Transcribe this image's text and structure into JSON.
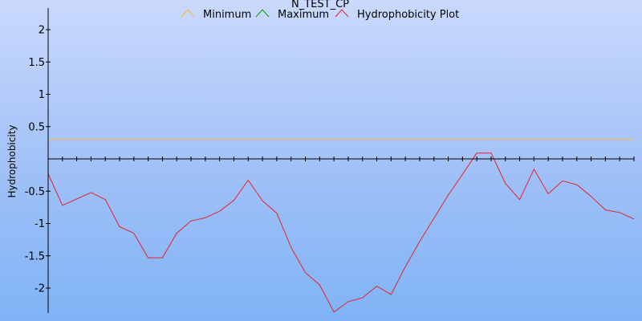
{
  "chart_data": {
    "type": "line",
    "title": "N_TEST_CP",
    "xlabel": "",
    "ylabel": "Hydrophobicity",
    "ylim": [
      -2.4,
      2.3
    ],
    "xlim": [
      0,
      41
    ],
    "yticks": [
      2,
      1.5,
      1,
      0.5,
      -0.5,
      -1,
      -1.5,
      -2
    ],
    "ytick_labels": [
      "2",
      "1.5",
      "1",
      "0.5",
      "-0.5",
      "-1",
      "-1.5",
      "-2"
    ],
    "grid": false,
    "legend_position": "top",
    "series": [
      {
        "name": "Minimum",
        "color": "#ffb733",
        "x": [
          0,
          41
        ],
        "values": [
          0.3,
          0.3
        ]
      },
      {
        "name": "Maximum",
        "color": "#00a000",
        "x": [],
        "values": []
      },
      {
        "name": "Hydrophobicity Plot",
        "color": "#e8202a",
        "x": [
          0,
          1,
          2,
          3,
          4,
          5,
          6,
          7,
          8,
          9,
          10,
          11,
          12,
          13,
          14,
          15,
          16,
          17,
          18,
          19,
          20,
          21,
          22,
          23,
          24,
          25,
          26,
          27,
          28,
          29,
          30,
          31,
          32,
          33,
          34,
          35,
          36,
          37,
          38,
          39,
          40,
          41
        ],
        "values": [
          -0.23,
          -0.72,
          -0.62,
          -0.52,
          -0.63,
          -1.05,
          -1.15,
          -1.53,
          -1.53,
          -1.15,
          -0.96,
          -0.91,
          -0.81,
          -0.64,
          -0.33,
          -0.65,
          -0.84,
          -1.37,
          -1.76,
          -1.95,
          -2.37,
          -2.21,
          -2.15,
          -1.97,
          -2.1,
          -1.67,
          -1.28,
          -0.92,
          -0.56,
          -0.24,
          0.09,
          0.09,
          -0.38,
          -0.63,
          -0.16,
          -0.54,
          -0.34,
          -0.4,
          -0.58,
          -0.79,
          -0.83,
          -0.93
        ]
      }
    ]
  }
}
